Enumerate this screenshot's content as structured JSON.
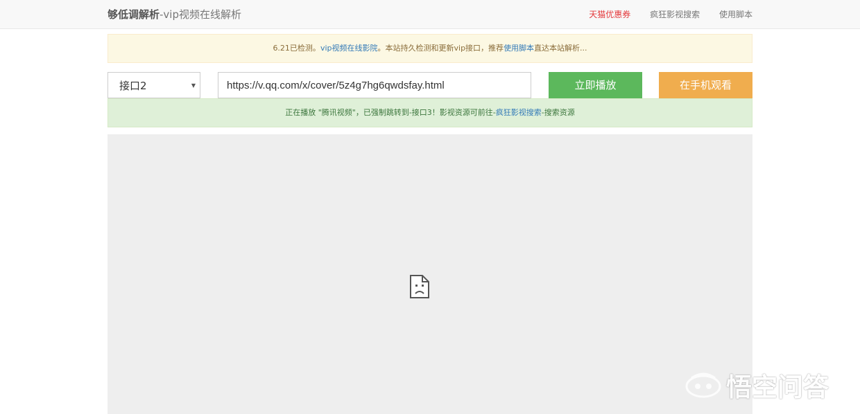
{
  "header": {
    "brand_strong": "够低调解析",
    "brand_rest": "-vip视频在线解析",
    "nav": {
      "coupon": "天猫优惠券",
      "search": "疯狂影视搜索",
      "script": "使用脚本"
    }
  },
  "notice": {
    "prefix": "6.21已检测。",
    "link1": "vip视频在线影院",
    "middle": "。本站持久检测和更新vip接口，推荐",
    "link2": "使用脚本",
    "suffix": "直达本站解析..."
  },
  "controls": {
    "interface_selected": "接口2",
    "url_value": "https://v.qq.com/x/cover/5z4g7hg6qwdsfay.html",
    "play_label": "立即播放",
    "mobile_label": "在手机观看"
  },
  "status": {
    "prefix": "正在播放 \"腾讯视频\"，已强制跳转到-接口3！影视资源可前往-",
    "link": "疯狂影视搜索",
    "suffix": "-搜索资源"
  },
  "watermark": {
    "text": "悟空问答",
    "icon": "wukong-logo-icon"
  },
  "player": {
    "icon": "broken-plugin-icon"
  },
  "colors": {
    "play_button": "#5cb85c",
    "mobile_button": "#f0ad4e",
    "coupon_link": "#e4393c",
    "player_bg": "#eeeeee"
  }
}
